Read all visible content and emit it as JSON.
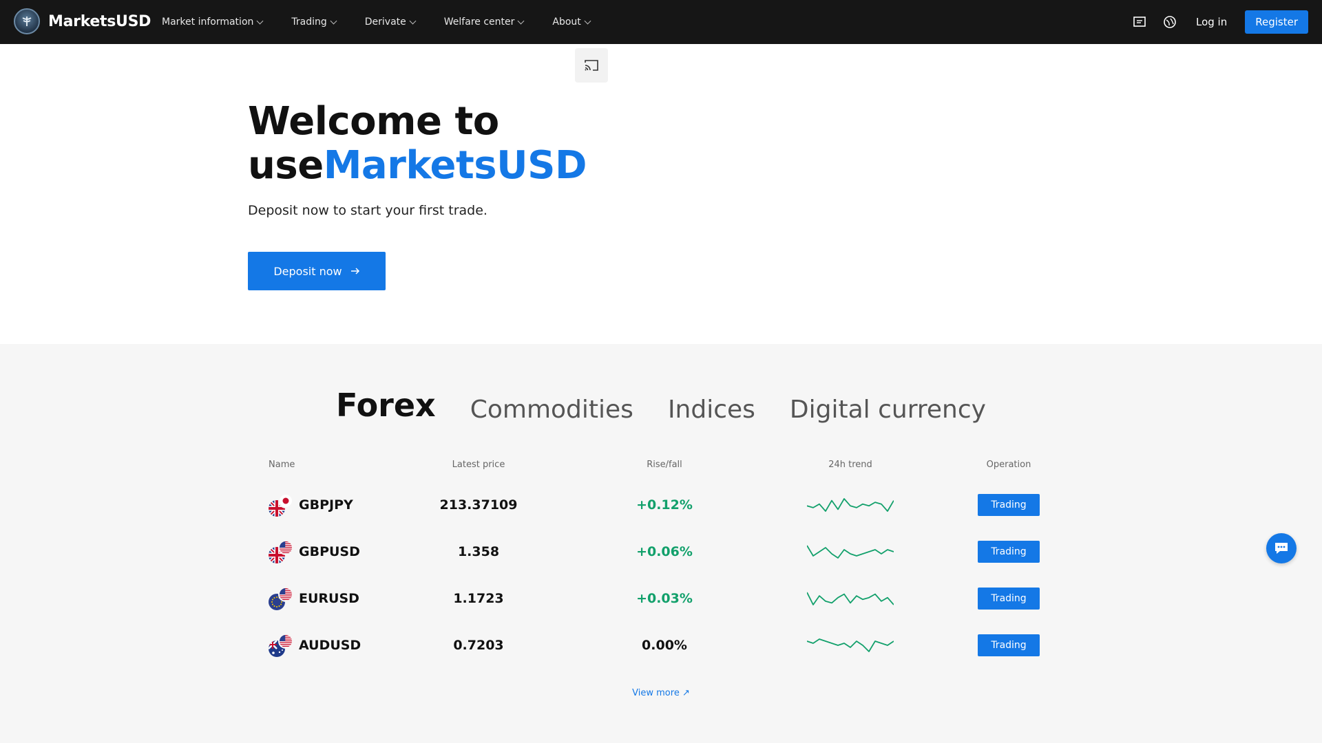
{
  "header": {
    "brand": "MarketsUSD",
    "nav": [
      {
        "label": "Market information"
      },
      {
        "label": "Trading"
      },
      {
        "label": "Derivate"
      },
      {
        "label": "Welfare center"
      },
      {
        "label": "About"
      }
    ],
    "login_label": "Log in",
    "register_label": "Register",
    "icons": [
      "news-icon",
      "language-icon"
    ]
  },
  "hero": {
    "title_line1": "Welcome to",
    "title_prefix": "use",
    "title_brand": "MarketsUSD",
    "subtitle": "Deposit now to start your first trade.",
    "deposit_label": "Deposit now"
  },
  "market": {
    "tabs": [
      {
        "label": "Forex",
        "active": true
      },
      {
        "label": "Commodities",
        "active": false
      },
      {
        "label": "Indices",
        "active": false
      },
      {
        "label": "Digital currency",
        "active": false
      }
    ],
    "columns": {
      "name": "Name",
      "price": "Latest price",
      "rise": "Rise/fall",
      "trend": "24h trend",
      "operation": "Operation"
    },
    "rows": [
      {
        "name": "GBPJPY",
        "price": "213.37109",
        "rise": "+0.12%",
        "direction": "up",
        "flags": [
          "uk",
          "jp"
        ],
        "trend": [
          5,
          4,
          6,
          2,
          8,
          3,
          9,
          5,
          4,
          6,
          5,
          7,
          6,
          2,
          8
        ]
      },
      {
        "name": "GBPUSD",
        "price": "1.358",
        "rise": "+0.06%",
        "direction": "up",
        "flags": [
          "uk",
          "us"
        ],
        "trend": [
          8,
          3,
          5,
          7,
          4,
          2,
          6,
          4,
          3,
          4,
          5,
          6,
          4,
          6,
          5
        ]
      },
      {
        "name": "EURUSD",
        "price": "1.1723",
        "rise": "+0.03%",
        "direction": "up",
        "flags": [
          "eu",
          "us"
        ],
        "trend": [
          9,
          2,
          7,
          4,
          3,
          6,
          8,
          3,
          7,
          5,
          6,
          8,
          4,
          6,
          2
        ]
      },
      {
        "name": "AUDUSD",
        "price": "0.7203",
        "rise": "0.00%",
        "direction": "flat",
        "flags": [
          "au",
          "us"
        ],
        "trend": [
          6,
          5,
          7,
          6,
          5,
          4,
          5,
          3,
          6,
          4,
          1,
          6,
          5,
          4,
          6
        ]
      }
    ],
    "trade_label": "Trading",
    "view_more": "View more ↗",
    "trend_color": "#12a06b"
  },
  "colors": {
    "accent": "#1478e6",
    "up": "#12a06b",
    "header_bg": "#161616"
  }
}
